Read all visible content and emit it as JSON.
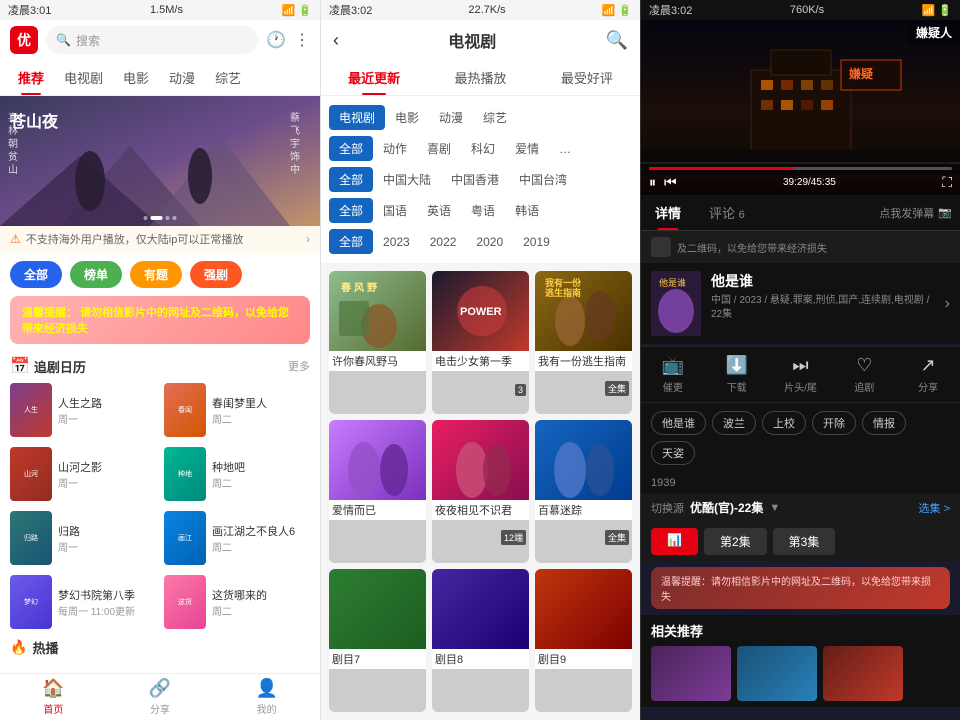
{
  "panel1": {
    "status": {
      "time": "凌晨3:01",
      "network": "1.5M/s",
      "right_icons": "📶 🔋"
    },
    "search": {
      "placeholder": "搜索"
    },
    "nav": {
      "items": [
        {
          "label": "推荐",
          "active": true
        },
        {
          "label": "电视剧"
        },
        {
          "label": "电影"
        },
        {
          "label": "动漫"
        },
        {
          "label": "综艺"
        }
      ]
    },
    "banner": {
      "subtitle": "苍山夜"
    },
    "notice": {
      "text": "不支持海外用户播放，仅大陆ip可以正常播放"
    },
    "tags": [
      {
        "label": "全部",
        "style": "active"
      },
      {
        "label": "榜单",
        "style": "t2"
      },
      {
        "label": "有题",
        "style": "t3"
      },
      {
        "label": "强剧",
        "style": "t4"
      }
    ],
    "warning": {
      "text1": "温馨提醒：",
      "text2": "请勿相信影片中的网址及二维码，以免给您带来经济损失"
    },
    "drama_section": {
      "title": "追剧日历",
      "more": "更多"
    },
    "dramas_col1": [
      {
        "name": "人生之路",
        "day": "周一",
        "color": "#7b3f8e"
      },
      {
        "name": "山河之影",
        "day": "周一",
        "color": "#c0392b"
      },
      {
        "name": "归路",
        "day": "周一",
        "color": "#2c7873"
      },
      {
        "name": "梦幻书院第八季",
        "day": "每周一 11:00更新",
        "color": "#6c5ce7"
      }
    ],
    "dramas_col2": [
      {
        "name": "春闺梦里人",
        "day": "周二",
        "color": "#e17055"
      },
      {
        "name": "种地吧",
        "day": "周二",
        "color": "#00b894"
      },
      {
        "name": "画江湖之不良人6",
        "day": "周二",
        "color": "#0984e3"
      },
      {
        "name": "这货哪来的",
        "day": "周二",
        "color": "#fd79a8"
      }
    ],
    "hot_section": {
      "title": "热播"
    },
    "bottom_nav": [
      {
        "label": "首页",
        "icon": "🏠",
        "active": true
      },
      {
        "label": "分享",
        "icon": "🔗"
      },
      {
        "label": "我的",
        "icon": "👤"
      }
    ]
  },
  "panel2": {
    "status": {
      "time": "凌晨3:02",
      "network": "22.7K/s"
    },
    "header": {
      "title": "电视剧"
    },
    "tabs": [
      {
        "label": "最近更新",
        "active": true
      },
      {
        "label": "最热播放"
      },
      {
        "label": "最受好评"
      }
    ],
    "filter_rows": [
      {
        "items": [
          {
            "label": "电视剧",
            "active": true
          },
          {
            "label": "电影"
          },
          {
            "label": "动漫"
          },
          {
            "label": "综艺"
          }
        ]
      },
      {
        "items": [
          {
            "label": "全部",
            "active": true
          },
          {
            "label": "动作"
          },
          {
            "label": "喜剧"
          },
          {
            "label": "科幻"
          },
          {
            "label": "爱情"
          },
          {
            "label": "…"
          }
        ]
      },
      {
        "items": [
          {
            "label": "全部",
            "active": true
          },
          {
            "label": "中国大陆"
          },
          {
            "label": "中国香港"
          },
          {
            "label": "中国台湾"
          }
        ]
      },
      {
        "items": [
          {
            "label": "全部",
            "active": true
          },
          {
            "label": "国语"
          },
          {
            "label": "英语"
          },
          {
            "label": "粤语"
          },
          {
            "label": "韩语"
          }
        ]
      },
      {
        "items": [
          {
            "label": "全部",
            "active": true
          },
          {
            "label": "2023"
          },
          {
            "label": "2022"
          },
          {
            "label": "2020"
          },
          {
            "label": "2019"
          }
        ]
      }
    ],
    "grid": [
      {
        "title": "许你春风野马",
        "ep": "",
        "badge": "",
        "color1": "#8fbc8f",
        "color2": "#556b2f"
      },
      {
        "title": "电击少女第一季",
        "ep": "3",
        "badge": "",
        "color1": "#c0392b",
        "color2": "#7f0000"
      },
      {
        "title": "我有一份逃生指南",
        "ep": "全集",
        "badge": "",
        "color1": "#8b6914",
        "color2": "#4a3000"
      },
      {
        "title": "爱情而已",
        "ep": "",
        "badge": "",
        "color1": "#c77dff",
        "color2": "#7b2fbe"
      },
      {
        "title": "夜夜相见不识君",
        "ep": "12端",
        "badge": "",
        "color1": "#e91e63",
        "color2": "#880e4f"
      },
      {
        "title": "百慕迷踪",
        "ep": "全集",
        "badge": "",
        "color1": "#1565c0",
        "color2": "#003c8f"
      },
      {
        "title": "剧目7",
        "ep": "",
        "badge": "",
        "color1": "#2e7d32",
        "color2": "#1b5e20"
      },
      {
        "title": "剧目8",
        "ep": "",
        "badge": "",
        "color1": "#4527a0",
        "color2": "#1a0072"
      },
      {
        "title": "剧目9",
        "ep": "",
        "badge": "",
        "color1": "#bf360c",
        "color2": "#7f0000"
      }
    ]
  },
  "panel3": {
    "status": {
      "time": "凌晨3:02",
      "network": "760K/s",
      "title": "嫌疑人"
    },
    "video": {
      "progress_pct": 48,
      "time": "39:29/45:35"
    },
    "tabs": [
      {
        "label": "详情",
        "active": true
      },
      {
        "label": "评论",
        "count": "6"
      }
    ],
    "report_btn": "点我发弹幕",
    "qr_warning": "及二维码，以免给您带来经济损失",
    "show": {
      "title": "他是谁",
      "meta": "中国 / 2023 / 悬疑,罪案,刑侦,国产,连续剧,电视剧 / 22集"
    },
    "actions": [
      {
        "icon": "📺",
        "label": "催更"
      },
      {
        "icon": "⬇️",
        "label": "下载"
      },
      {
        "icon": "⏭",
        "label": "片头/尾"
      },
      {
        "icon": "❤️",
        "label": "追剧"
      },
      {
        "icon": "↗️",
        "label": "分享"
      }
    ],
    "tag_chips": [
      "他是谁",
      "波兰",
      "上校",
      "开除",
      "情报",
      "天姿"
    ],
    "ep_count": "1939",
    "source": {
      "label": "切换源",
      "value": "优酷(官)-22集",
      "right": "选集 >"
    },
    "episodes": [
      {
        "label": "第2集"
      },
      {
        "label": "第3集"
      }
    ],
    "warning2": "温馨提醒：请勿相信影片中的网址及二维码，以免给您带来损失",
    "related": {
      "title": "相关推荐",
      "items": [
        {
          "color1": "#4a235a",
          "color2": "#7d3c98"
        },
        {
          "color1": "#1a5276",
          "color2": "#2980b9"
        },
        {
          "color1": "#641e16",
          "color2": "#c0392b"
        }
      ]
    }
  }
}
